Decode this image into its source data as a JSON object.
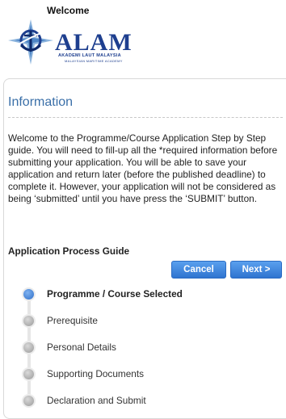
{
  "header": {
    "welcome": "Welcome",
    "logo": {
      "name": "ALAM",
      "subtitle1": "AKADEMI LAUT MALAYSIA",
      "subtitle2": "MALAYSIAN MARITIME ACADEMY",
      "color": "#1e3f8f"
    }
  },
  "panel": {
    "title": "Information",
    "intro": "Welcome to the Programme/Course Application Step by Step guide. You will need to fill-up all the *required information before submitting your application. You will be able to save your application and return later (before the published deadline) to complete it. However, your application will not be considered as being ‘submitted’ until you have press the ‘SUBMIT’ button.",
    "guide_title": "Application Process Guide",
    "buttons": {
      "cancel": "Cancel",
      "next": "Next >"
    },
    "steps": [
      {
        "label": "Programme / Course Selected",
        "active": true
      },
      {
        "label": "Prerequisite",
        "active": false
      },
      {
        "label": "Personal Details",
        "active": false
      },
      {
        "label": "Supporting Documents",
        "active": false
      },
      {
        "label": "Declaration and Submit",
        "active": false
      }
    ]
  },
  "colors": {
    "title_blue": "#3a6fa8",
    "button_blue": "#2f74d0",
    "active_step": "#2f6fc9",
    "inactive_step": "#9a9a9a"
  }
}
